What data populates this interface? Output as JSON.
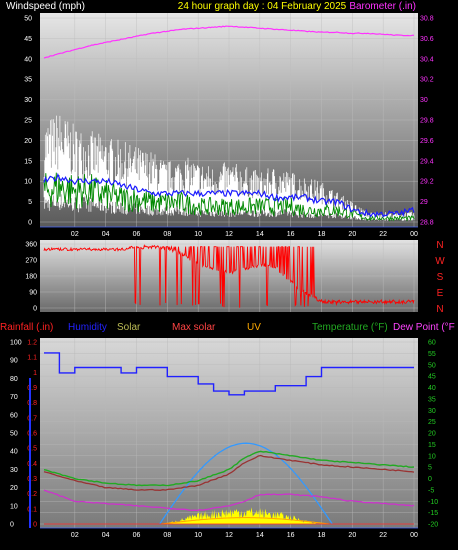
{
  "header": {
    "windspeed_label": "Windspeed (mph)",
    "title": "24 hour graph day : 04 February 2025",
    "barometer_label": "Barometer (.in)"
  },
  "panel3_header": {
    "rainfall": "Rainfall (.in)",
    "humidity": "Humidity",
    "solar": "Solar",
    "max_solar": "Max solar",
    "uv": "UV",
    "temperature": "Temperature (°F)",
    "dew_point": "Dew Point (°F"
  },
  "colors": {
    "wind": "#ffffff",
    "gust": "#ffffff",
    "avg_wind": "#1a1aff",
    "wind_green": "#008800",
    "barometer": "#ff33ff",
    "direction": "#ff0000",
    "humidity": "#2020ff",
    "temperature": "#22aa22",
    "dew_point": "#cc33cc",
    "apparent": "#993333",
    "solar": "#ffff00",
    "max_solar": "#3399ff",
    "uv": "#ffaa00"
  },
  "chart_data": [
    {
      "type": "line",
      "name": "wind_barometer",
      "x_ticks": [
        "02",
        "04",
        "06",
        "08",
        "10",
        "12",
        "14",
        "16",
        "18",
        "20",
        "22",
        "00"
      ],
      "y_left_ticks": [
        "0",
        "5",
        "10",
        "15",
        "20",
        "25",
        "30",
        "35",
        "40",
        "45",
        "50"
      ],
      "y_left_range": [
        0,
        50
      ],
      "y_right_ticks": [
        "28.8",
        "29",
        "29.2",
        "29.4",
        "29.6",
        "29.8",
        "30",
        "30.2",
        "30.4",
        "30.6",
        "30.8"
      ],
      "y_right_range": [
        28.8,
        30.8
      ],
      "x_hours": [
        0,
        1,
        2,
        3,
        4,
        5,
        6,
        7,
        8,
        9,
        10,
        11,
        12,
        13,
        14,
        15,
        16,
        17,
        18,
        19,
        20,
        21,
        22,
        23,
        24
      ],
      "gust": [
        20,
        22,
        19,
        18,
        17,
        16,
        15,
        14,
        12,
        13,
        12,
        11,
        12,
        11,
        10,
        11,
        10,
        9,
        8,
        6,
        4,
        2,
        2,
        2,
        2
      ],
      "wind": [
        12,
        12,
        11,
        11,
        10,
        10,
        9,
        8,
        7,
        7,
        7,
        6,
        7,
        6,
        6,
        6,
        6,
        5,
        5,
        4,
        2,
        1,
        1,
        1,
        1
      ],
      "avg_wind": [
        10,
        11,
        10,
        10,
        10,
        9,
        8,
        7,
        7,
        7,
        7,
        7,
        7,
        7,
        7,
        6,
        6,
        6,
        5,
        5,
        3,
        2,
        2,
        2,
        3
      ],
      "green_wind": [
        8,
        9,
        8,
        8,
        7,
        6,
        6,
        5,
        5,
        5,
        4,
        4,
        4,
        4,
        4,
        4,
        4,
        3,
        3,
        3,
        2,
        1,
        1,
        1,
        1
      ],
      "barometer": [
        30.41,
        30.45,
        30.49,
        30.53,
        30.56,
        30.59,
        30.62,
        30.65,
        30.67,
        30.69,
        30.7,
        30.71,
        30.72,
        30.71,
        30.7,
        30.69,
        30.68,
        30.67,
        30.66,
        30.66,
        30.65,
        30.65,
        30.64,
        30.63,
        30.63
      ]
    },
    {
      "type": "scatter",
      "name": "wind_direction",
      "y_ticks": [
        "0",
        "90",
        "180",
        "270",
        "360"
      ],
      "y_range": [
        0,
        360
      ],
      "compass_labels": [
        "N",
        "W",
        "S",
        "E",
        "N"
      ],
      "direction_hours": [
        0,
        1,
        2,
        3,
        4,
        5,
        6,
        7,
        8,
        9,
        10,
        11,
        12,
        13,
        14,
        15,
        16,
        17,
        18,
        19,
        20,
        21,
        22,
        23,
        24
      ],
      "direction": [
        320,
        330,
        335,
        335,
        335,
        340,
        340,
        345,
        340,
        300,
        250,
        220,
        200,
        220,
        240,
        230,
        150,
        80,
        40,
        30,
        35,
        30,
        28,
        32,
        35
      ]
    },
    {
      "type": "line",
      "name": "rain_humidity_temp",
      "x_ticks": [
        "02",
        "04",
        "06",
        "08",
        "10",
        "12",
        "14",
        "16",
        "18",
        "20",
        "22",
        "00"
      ],
      "rain_ticks": [
        "0",
        "0.1",
        "0.2",
        "0.3",
        "0.4",
        "0.5",
        "0.6",
        "0.7",
        "0.8",
        "0.9",
        "1",
        "1.1",
        "1.2"
      ],
      "humidity_ticks": [
        "0",
        "10",
        "20",
        "30",
        "40",
        "50",
        "60",
        "70",
        "80",
        "90",
        "100"
      ],
      "temp_ticks": [
        "-20",
        "-15",
        "-10",
        "-5",
        "0",
        "5",
        "10",
        "15",
        "20",
        "25",
        "30",
        "35",
        "40",
        "45",
        "50",
        "55",
        "60"
      ],
      "temp_range": [
        -20,
        60
      ],
      "humidity_hours": [
        0,
        1,
        1,
        2,
        2,
        5,
        5,
        6,
        6,
        8,
        8,
        10,
        10,
        11,
        11,
        12,
        12,
        13,
        13,
        15,
        15,
        17,
        17,
        18,
        18,
        24
      ],
      "humidity": [
        94,
        94,
        83,
        83,
        86,
        86,
        83,
        83,
        86,
        86,
        81,
        81,
        77,
        77,
        73,
        73,
        71,
        71,
        73,
        73,
        76,
        76,
        81,
        81,
        86,
        86
      ],
      "temp_hours": [
        0,
        2,
        4,
        6,
        8,
        10,
        12,
        13,
        14,
        16,
        18,
        20,
        22,
        24
      ],
      "temperature": [
        4,
        0,
        -2,
        -3,
        -3,
        -1,
        4,
        9,
        12,
        10,
        8,
        7,
        6,
        5
      ],
      "apparent": [
        3,
        -1,
        -4,
        -5,
        -5,
        -3,
        2,
        7,
        10,
        8,
        6,
        5,
        4,
        3
      ],
      "dew_point": [
        -5,
        -10,
        -11,
        -12,
        -13,
        -14,
        -12,
        -10,
        -7,
        -7,
        -8,
        -10,
        -11,
        -12
      ],
      "max_solar_peak_hour": 13.2,
      "max_solar_span": [
        7.5,
        18.7
      ],
      "rain_total": 0
    }
  ]
}
